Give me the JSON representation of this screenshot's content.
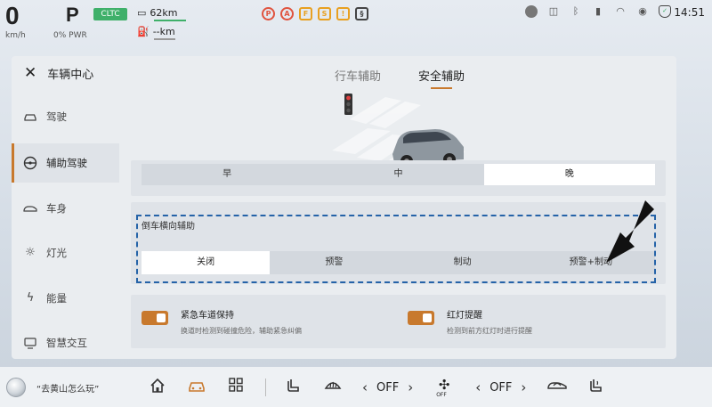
{
  "status": {
    "speed": "0",
    "speed_unit": "km/h",
    "gear": "P",
    "power": "0% PWR",
    "cycle_badge": "CLTC",
    "range_ev": "62km",
    "range_fuel": "--km",
    "time": "14:51",
    "warning_icons": [
      "parking-brake-warning-icon",
      "airbag-warning-icon",
      "fuel-warning-icon",
      "seatbelt-warning-icon",
      "tire-warning-icon",
      "traction-control-icon"
    ],
    "right_icons": [
      "avatar",
      "camera-off-icon",
      "bluetooth-icon",
      "signal-icon",
      "wifi-icon",
      "hotspot-icon",
      "shield-icon"
    ]
  },
  "sidebar": {
    "title": "车辆中心",
    "items": [
      {
        "label": "驾驶",
        "icon": "car-icon"
      },
      {
        "label": "辅助驾驶",
        "icon": "steering-wheel-icon",
        "active": true
      },
      {
        "label": "车身",
        "icon": "car-body-icon"
      },
      {
        "label": "灯光",
        "icon": "light-icon"
      },
      {
        "label": "能量",
        "icon": "energy-icon"
      },
      {
        "label": "智慧交互",
        "icon": "interaction-icon"
      }
    ]
  },
  "tabs": [
    {
      "label": "行车辅助",
      "active": false
    },
    {
      "label": "安全辅助",
      "active": true
    }
  ],
  "timing_options": {
    "options": [
      "早",
      "中",
      "晚"
    ],
    "selected": "晚"
  },
  "rear_cross_traffic": {
    "title": "倒车横向辅助",
    "options": [
      "关闭",
      "预警",
      "制动",
      "预警+制动"
    ],
    "selected": "关闭"
  },
  "toggles": [
    {
      "title": "紧急车道保持",
      "desc": "换道时检测到碰撞危险，辅助紧急纠偏",
      "on": true
    },
    {
      "title": "红灯提醒",
      "desc": "检测到前方红灯时进行提醒",
      "on": true
    }
  ],
  "dock": {
    "assistant_text": "“去黄山怎么玩”",
    "left_temp": "OFF",
    "right_temp": "OFF",
    "fan_label": "OFF",
    "accent_color": "#c8792d"
  }
}
